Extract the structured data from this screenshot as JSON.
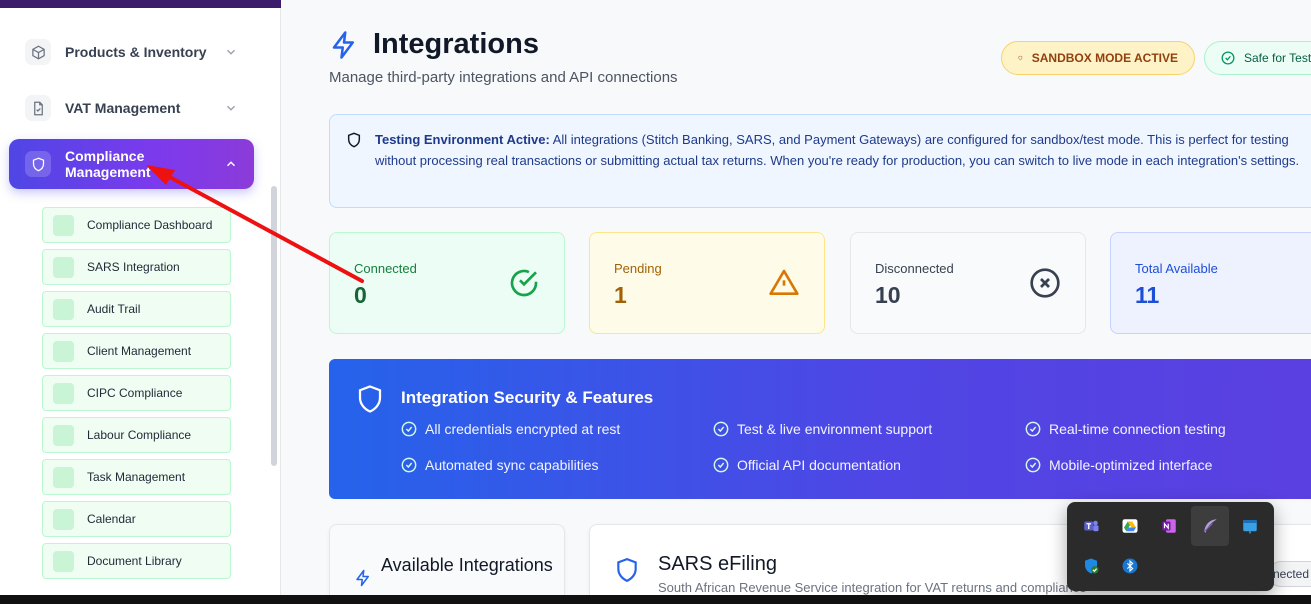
{
  "sidebar": {
    "nav": [
      {
        "label": "Products & Inventory",
        "icon": "box-icon"
      },
      {
        "label": "VAT Management",
        "icon": "document-icon"
      },
      {
        "label": "Compliance Management",
        "icon": "shield-icon",
        "active": true
      }
    ],
    "sub_items": [
      "Compliance Dashboard",
      "SARS Integration",
      "Audit Trail",
      "Client Management",
      "CIPC Compliance",
      "Labour Compliance",
      "Task Management",
      "Calendar",
      "Document Library"
    ]
  },
  "header": {
    "title": "Integrations",
    "subtitle": "Manage third-party integrations and API connections",
    "badges": {
      "sandbox": "SANDBOX MODE ACTIVE",
      "safe": "Safe for Test"
    }
  },
  "info": {
    "lead": "Testing Environment Active:",
    "body": " All integrations (Stitch Banking, SARS, and Payment Gateways) are configured for sandbox/test mode. This is perfect for testing without processing real transactions or submitting actual tax returns. When you're ready for production, you can switch to live mode in each integration's settings."
  },
  "stats": {
    "connected": {
      "label": "Connected",
      "value": "0"
    },
    "pending": {
      "label": "Pending",
      "value": "1"
    },
    "disconnected": {
      "label": "Disconnected",
      "value": "10"
    },
    "total": {
      "label": "Total Available",
      "value": "11"
    }
  },
  "security": {
    "title": "Integration Security & Features",
    "features": [
      "All credentials encrypted at rest",
      "Test & live environment support",
      "Real-time connection testing",
      "Automated sync capabilities",
      "Official API documentation",
      "Mobile-optimized interface"
    ]
  },
  "available": {
    "title": "Available Integrations"
  },
  "sars": {
    "title": "SARS eFiling",
    "description": "South African Revenue Service integration for VAT returns and compliance",
    "status_partial": "nected"
  },
  "tray_icons": [
    "teams-icon",
    "google-drive-icon",
    "onenote-icon",
    "feather-icon",
    "app-window-icon",
    "windows-security-icon",
    "bluetooth-icon"
  ],
  "colors": {
    "accent": "#4f46e5",
    "active_nav_gradient_end": "#8b3bd9",
    "success": "#16a34a",
    "warning": "#d97706",
    "annotation_arrow": "#ee1111"
  }
}
